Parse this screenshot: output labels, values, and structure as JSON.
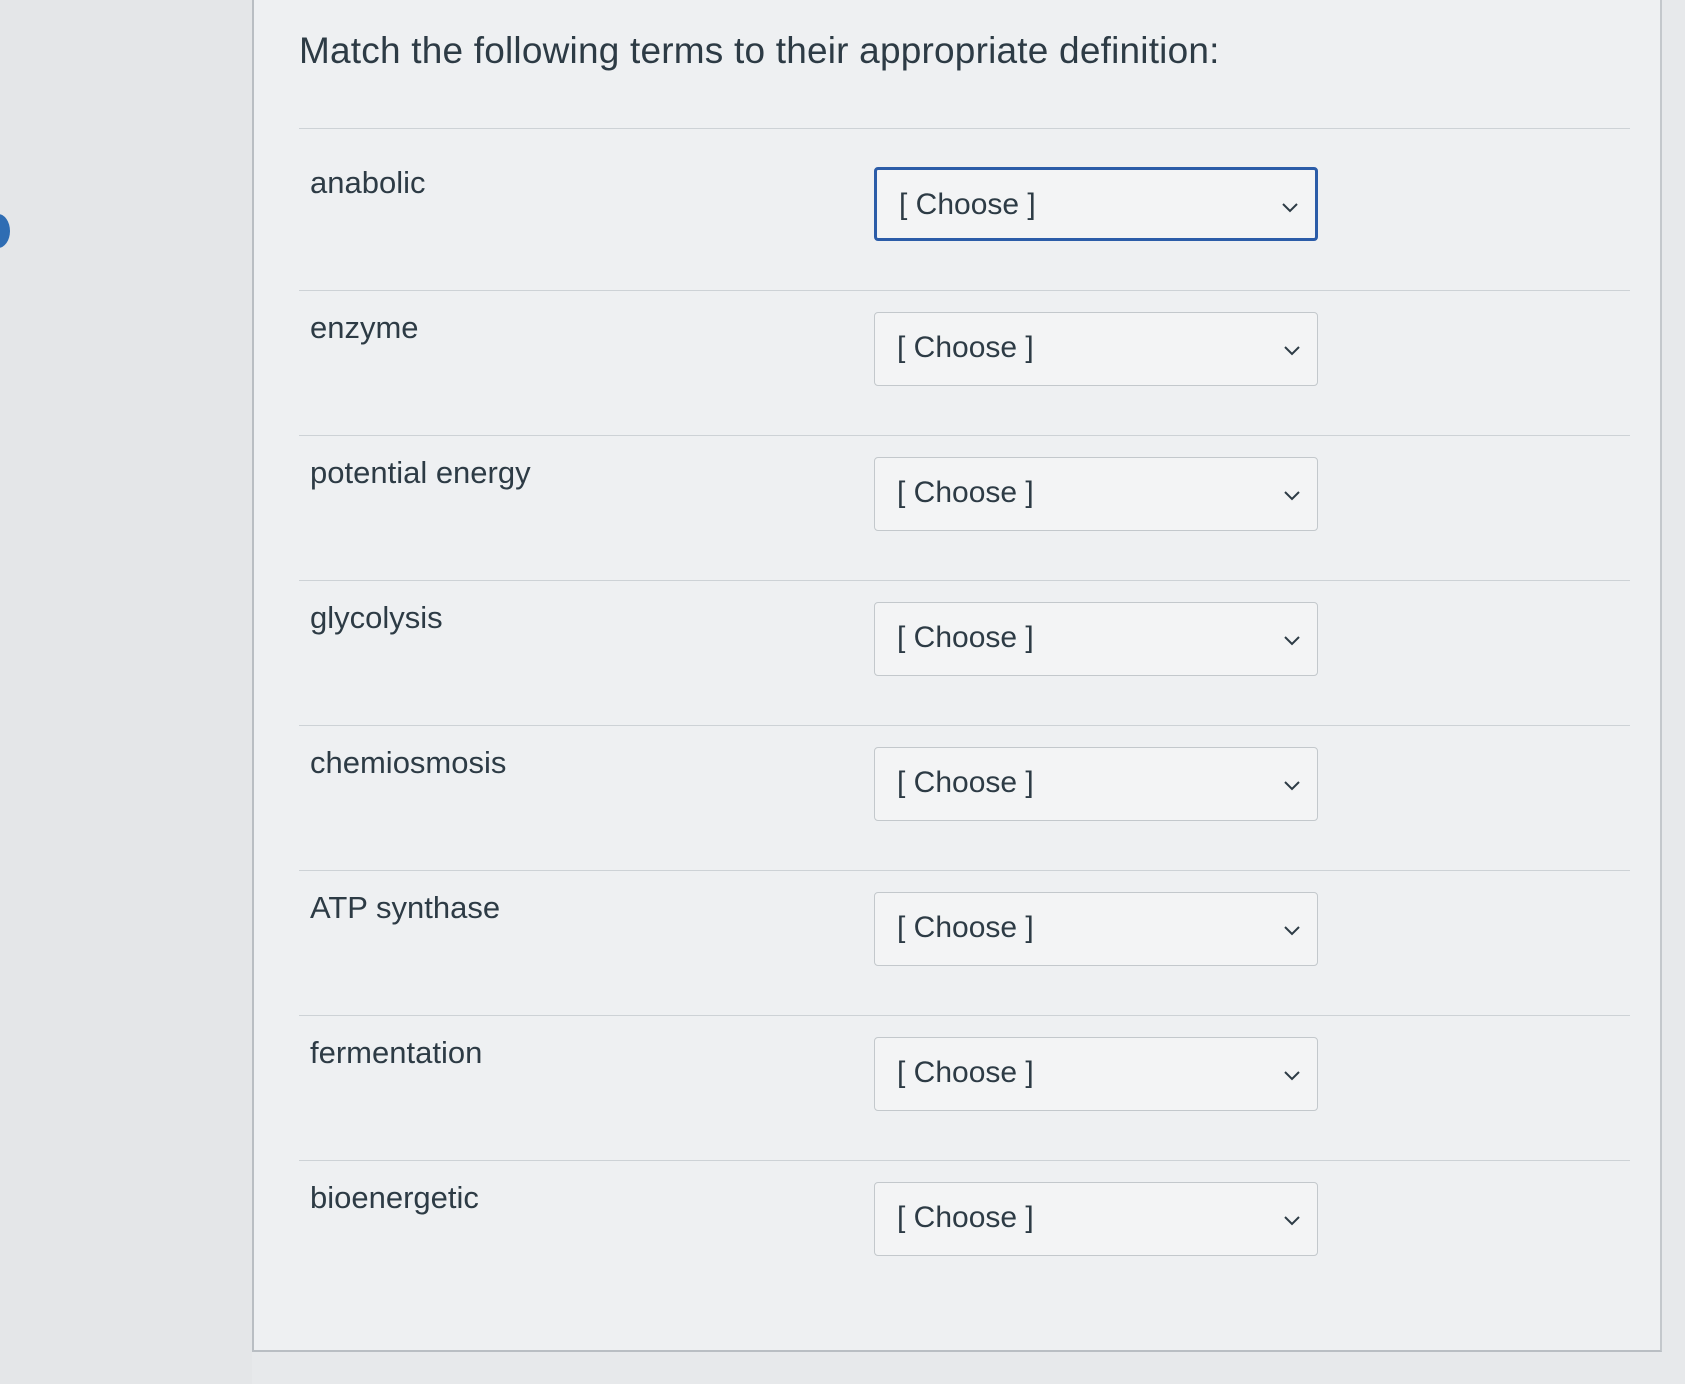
{
  "question": {
    "title": "Match the following terms to their appropriate definition:"
  },
  "rows": [
    {
      "term": "anabolic",
      "selected": "[ Choose ]"
    },
    {
      "term": "enzyme",
      "selected": "[ Choose ]"
    },
    {
      "term": "potential energy",
      "selected": "[ Choose ]"
    },
    {
      "term": "glycolysis",
      "selected": "[ Choose ]"
    },
    {
      "term": "chemiosmosis",
      "selected": "[ Choose ]"
    },
    {
      "term": "ATP synthase",
      "selected": "[ Choose ]"
    },
    {
      "term": "fermentation",
      "selected": "[ Choose ]"
    },
    {
      "term": "bioenergetic",
      "selected": "[ Choose ]"
    }
  ],
  "colors": {
    "text": "#2d3b45",
    "focus_border": "#2b5ca8",
    "page_bg": "#e7e9eb",
    "card_bg": "#eef0f2"
  },
  "icons": {
    "dropdown": "chevron-down-icon"
  }
}
